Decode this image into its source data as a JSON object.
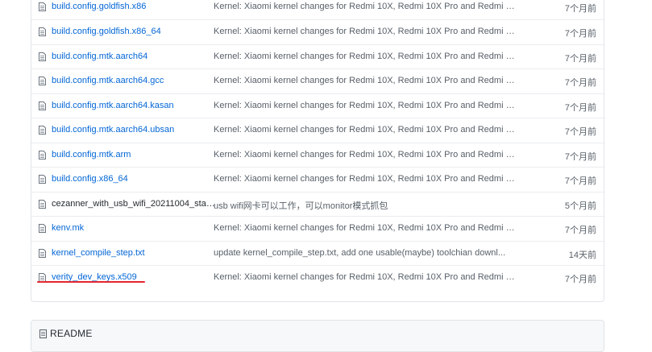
{
  "files": [
    {
      "name": "build.config.goldfish.x86",
      "message": "Kernel: Xiaomi kernel changes for Redmi 10X, Redmi 10X Pro and Redmi K...",
      "age": "7个月前"
    },
    {
      "name": "build.config.goldfish.x86_64",
      "message": "Kernel: Xiaomi kernel changes for Redmi 10X, Redmi 10X Pro and Redmi K...",
      "age": "7个月前"
    },
    {
      "name": "build.config.mtk.aarch64",
      "message": "Kernel: Xiaomi kernel changes for Redmi 10X, Redmi 10X Pro and Redmi K...",
      "age": "7个月前"
    },
    {
      "name": "build.config.mtk.aarch64.gcc",
      "message": "Kernel: Xiaomi kernel changes for Redmi 10X, Redmi 10X Pro and Redmi K...",
      "age": "7个月前"
    },
    {
      "name": "build.config.mtk.aarch64.kasan",
      "message": "Kernel: Xiaomi kernel changes for Redmi 10X, Redmi 10X Pro and Redmi K...",
      "age": "7个月前"
    },
    {
      "name": "build.config.mtk.aarch64.ubsan",
      "message": "Kernel: Xiaomi kernel changes for Redmi 10X, Redmi 10X Pro and Redmi K...",
      "age": "7个月前"
    },
    {
      "name": "build.config.mtk.arm",
      "message": "Kernel: Xiaomi kernel changes for Redmi 10X, Redmi 10X Pro and Redmi K...",
      "age": "7个月前"
    },
    {
      "name": "build.config.x86_64",
      "message": "Kernel: Xiaomi kernel changes for Redmi 10X, Redmi 10X Pro and Redmi K...",
      "age": "7个月前"
    },
    {
      "name": "cezanner_with_usb_wifi_20211004_stab...",
      "message": "usb wifi网卡可以工作，可以monitor模式抓包",
      "age": "5个月前"
    },
    {
      "name": "kenv.mk",
      "message": "Kernel: Xiaomi kernel changes for Redmi 10X, Redmi 10X Pro and Redmi K...",
      "age": "7个月前"
    },
    {
      "name": "kernel_compile_step.txt",
      "message": "update kernel_compile_step.txt, add one usable(maybe) toolchian downl...",
      "age": "14天前"
    },
    {
      "name": "verity_dev_keys.x509",
      "message": "Kernel: Xiaomi kernel changes for Redmi 10X, Redmi 10X Pro and Redmi K...",
      "age": "7个月前"
    }
  ],
  "readme": {
    "label": "README"
  },
  "colors": {
    "link": "#0366d6",
    "muted": "#586069",
    "annotation": "#e3262f"
  },
  "icons": {
    "file": "file-icon",
    "readme": "list-icon"
  }
}
